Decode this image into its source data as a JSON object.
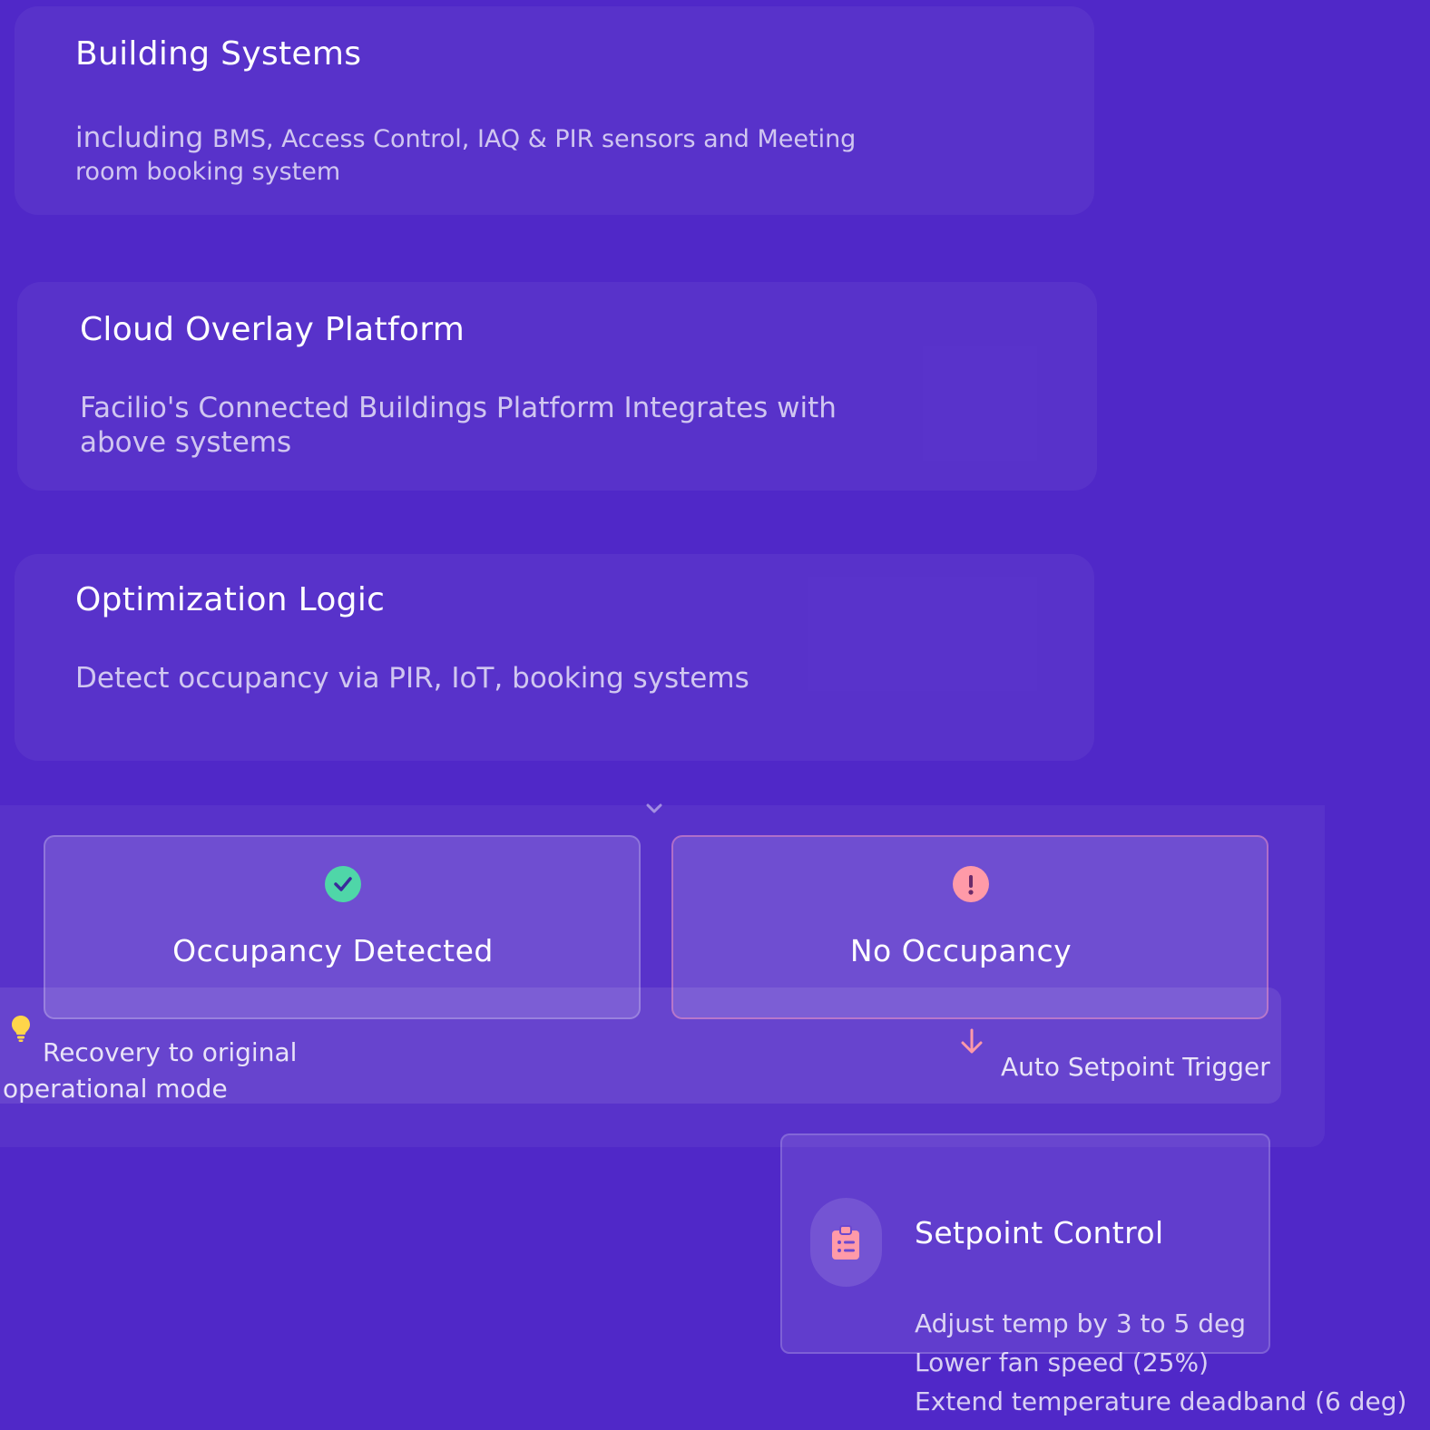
{
  "cards": [
    {
      "title": "Building Systems",
      "desc_lead": "including",
      "desc_rest": "BMS, Access Control, IAQ & PIR sensors and Meeting room booking system"
    },
    {
      "title": "Cloud Overlay Platform",
      "desc": "Facilio's Connected Buildings Platform Integrates with above systems"
    },
    {
      "title": "Optimization Logic",
      "desc": "Detect occupancy via PIR, IoT, booking systems"
    }
  ],
  "branches": {
    "occupied": {
      "label": "Occupancy Detected",
      "icon": "check-circle-icon"
    },
    "vacant": {
      "label": "No Occupancy",
      "icon": "exclamation-circle-icon"
    }
  },
  "footer": {
    "recovery": "Recovery to original operational mode",
    "trigger": "Auto Setpoint Trigger"
  },
  "setpoint": {
    "title": "Setpoint Control",
    "items": [
      "Adjust temp by 3 to 5 deg",
      "Lower fan speed (25%)",
      "Extend temperature deadband (6 deg)"
    ]
  },
  "colors": {
    "background": "#5028c8",
    "check": "#4fd6a8",
    "alert": "#ff9aa8",
    "bulb": "#ffd54a",
    "clipboard": "#ff9aa8"
  }
}
